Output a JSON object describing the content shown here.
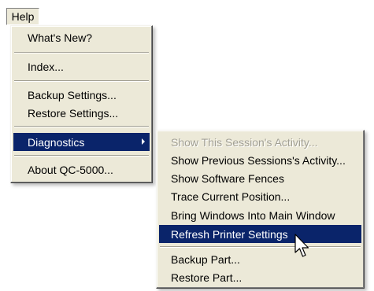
{
  "menubar": {
    "help": "Help"
  },
  "main_menu": {
    "items": [
      {
        "label": "What's New?"
      },
      {
        "label": "Index..."
      },
      {
        "label": "Backup Settings..."
      },
      {
        "label": "Restore Settings..."
      },
      {
        "label": "Diagnostics"
      },
      {
        "label": "About QC-5000..."
      }
    ]
  },
  "diagnostics_menu": {
    "items": [
      {
        "label": "Show This Session's Activity...",
        "state": "disabled"
      },
      {
        "label": "Show Previous Sessions's Activity..."
      },
      {
        "label": "Show Software Fences"
      },
      {
        "label": "Trace Current Position..."
      },
      {
        "label": "Bring Windows Into Main Window"
      },
      {
        "label": "Refresh Printer Settings",
        "state": "highlighted"
      },
      {
        "label": "Backup Part..."
      },
      {
        "label": "Restore Part..."
      }
    ]
  },
  "colors": {
    "menu_background": "#ece9d8",
    "highlight": "#0a246a",
    "highlight_text": "#ffffff",
    "disabled_text": "#a19f93"
  },
  "icons": {
    "submenu_arrow": "chevron-right-icon",
    "cursor": "mouse-pointer-icon"
  }
}
